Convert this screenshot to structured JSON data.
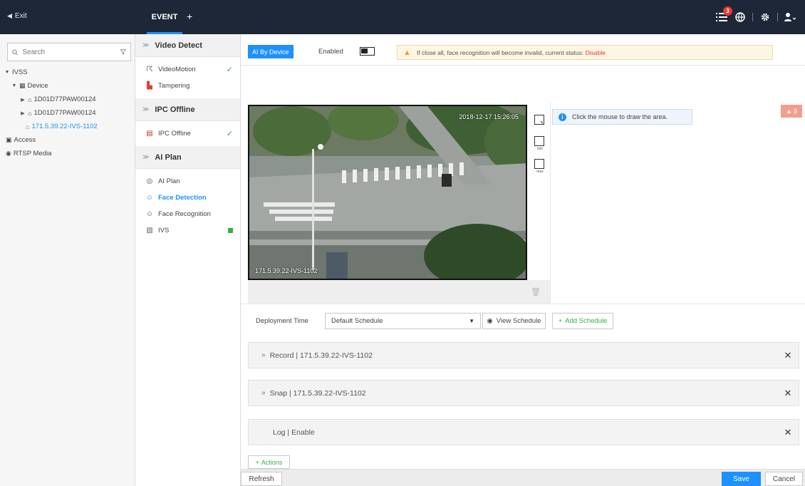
{
  "topbar": {
    "exit_label": "Exit",
    "tab_label": "EVENT",
    "add_tab": "+",
    "alarm_count": "3",
    "colors": {
      "bar": "#1d2738",
      "accent": "#1e90ff"
    }
  },
  "sidebar": {
    "search_placeholder": "Search",
    "tree": {
      "root": "IVSS",
      "device": "Device",
      "devices": [
        "1D01D77PAW00124",
        "1D01D77PAW00124",
        "171.5.39.22-IVS-1102"
      ],
      "access": "Access",
      "rtsp": "RTSP Media"
    }
  },
  "events": {
    "groups": [
      {
        "title": "Video Detect",
        "items": [
          "VideoMotion",
          "Tampering"
        ]
      },
      {
        "title": "IPC Offline",
        "items": [
          "IPC Offline"
        ]
      },
      {
        "title": "AI Plan",
        "items": [
          "AI Plan",
          "Face Detection",
          "Face Recognition",
          "IVS"
        ]
      }
    ]
  },
  "main": {
    "ai_button": "AI By Device",
    "enabled_label": "Enabled",
    "warning_text": "If close all, face recognition will become invalid, current status:",
    "warning_status": "Disable",
    "video": {
      "timestamp": "2018-12-17 15:26:05",
      "channel_label": "171.5.39.22-IVS-1102"
    },
    "tools": [
      "min",
      "max"
    ],
    "hint_text": "Click the mouse to draw the area.",
    "alarm_tag": "9",
    "deployment_label": "Deployment Time",
    "schedule_value": "Default Schedule",
    "view_schedule": "View Schedule",
    "add_schedule": "Add Schedule",
    "actions": [
      {
        "label": "Record | 171.5.39.22-IVS-1102",
        "expand": "»"
      },
      {
        "label": "Snap | 171.5.39.22-IVS-1102",
        "expand": "»"
      },
      {
        "label": "Log | Enable",
        "expand": ""
      }
    ],
    "add_actions": "Actions",
    "refresh": "Refresh",
    "save": "Save",
    "cancel": "Cancel"
  }
}
